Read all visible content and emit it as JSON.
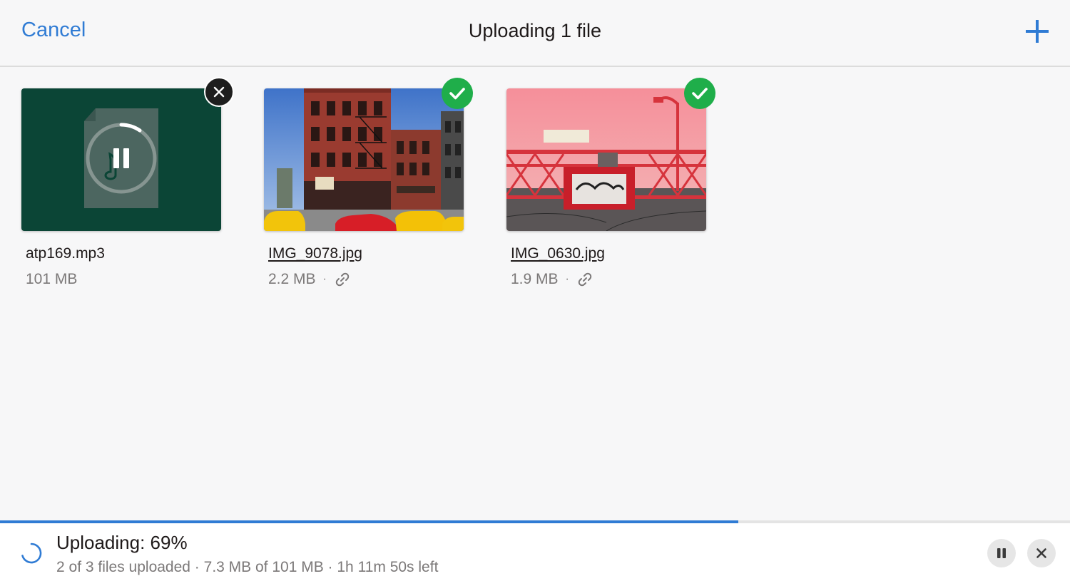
{
  "header": {
    "cancel_label": "Cancel",
    "title": "Uploading 1 file",
    "add_icon": "plus-icon"
  },
  "files": [
    {
      "name": "atp169.mp3",
      "size": "101 MB",
      "state": "paused",
      "badge_icon": "close-icon",
      "file_icon": "audio-file-icon"
    },
    {
      "name": "IMG_9078.jpg",
      "size": "2.2 MB",
      "state": "uploaded",
      "badge_icon": "checkmark-icon",
      "separator": "·",
      "link_icon": "link-icon"
    },
    {
      "name": "IMG_0630.jpg",
      "size": "1.9 MB",
      "state": "uploaded",
      "badge_icon": "checkmark-icon",
      "separator": "·",
      "link_icon": "link-icon"
    }
  ],
  "footer": {
    "status": "Uploading: 69%",
    "detail": "2 of 3 files uploaded · 7.3 MB of 101 MB · 1h 11m 50s left",
    "progress_fraction": 0.69,
    "pause_icon": "pause-icon",
    "cancel_icon": "close-icon"
  },
  "colors": {
    "accent": "#2f7bd4",
    "success": "#1fae4a",
    "audio_tile": "#0b4536"
  }
}
